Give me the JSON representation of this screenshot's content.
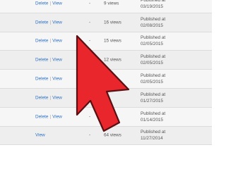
{
  "rows": [
    {
      "actions": [
        "Delete",
        "View"
      ],
      "dash": "-",
      "views": "9 views",
      "published_label": "Published at",
      "date": "03/19/2015"
    },
    {
      "actions": [
        "Delete",
        "View"
      ],
      "dash": "-",
      "views": "16 views",
      "published_label": "Published at",
      "date": "02/08/2015"
    },
    {
      "actions": [
        "Delete",
        "View"
      ],
      "dash": "-",
      "views": "15 views",
      "published_label": "Published at",
      "date": "02/05/2015"
    },
    {
      "actions": [
        "Delete",
        "View"
      ],
      "dash": "-",
      "views": "12 views",
      "published_label": "Published at",
      "date": "02/05/2015"
    },
    {
      "actions": [
        "Delete",
        "View"
      ],
      "dash": "-",
      "views": "",
      "published_label": "Published at",
      "date": "02/05/2015"
    },
    {
      "actions": [
        "Delete",
        "View"
      ],
      "dash": "-",
      "views": "",
      "published_label": "Published at",
      "date": "01/27/2015"
    },
    {
      "actions": [
        "Delete",
        "View"
      ],
      "dash": "-",
      "views": "",
      "published_label": "Published at",
      "date": "01/14/2015"
    },
    {
      "actions": [
        "View"
      ],
      "dash": "-",
      "views": "64 views",
      "published_label": "Published at",
      "date": "11/27/2014"
    }
  ],
  "colors": {
    "link": "#2a6fc1",
    "arrow_fill": "#e8262c",
    "arrow_outline": "#5a0f12",
    "row_bg_light": "#f6f6f6",
    "row_bg_dark": "#eeeeee"
  },
  "overlay": {
    "icon": "red-pointer-arrow-icon"
  }
}
